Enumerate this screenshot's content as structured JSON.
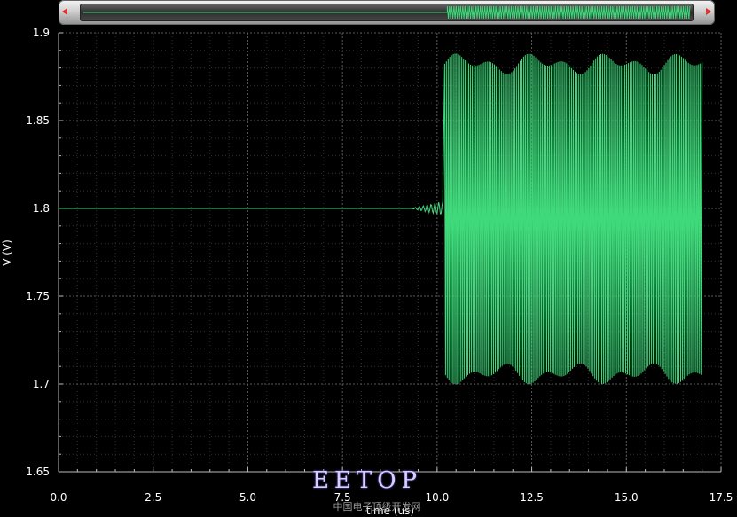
{
  "chart_data": {
    "type": "line",
    "title": "",
    "xlabel": "time (us)",
    "ylabel": "V (V)",
    "xlim": [
      0.0,
      17.5
    ],
    "ylim": [
      1.65,
      1.9
    ],
    "x_ticks": [
      "0.0",
      "2.5",
      "5.0",
      "7.5",
      "10.0",
      "12.5",
      "15.0",
      "17.5"
    ],
    "y_ticks": [
      "1.9",
      "1.85",
      "1.8",
      "1.75",
      "1.7",
      "1.65"
    ],
    "grid": true,
    "background": "#000000",
    "series": [
      {
        "color": "#3fd87a",
        "segments": [
          {
            "x_start": 0.0,
            "x_end": 9.3,
            "kind": "flat",
            "value": 1.8
          },
          {
            "x_start": 9.3,
            "x_end": 10.15,
            "kind": "small-ripple",
            "center": 1.8,
            "amplitude": 0.004
          },
          {
            "x_start": 10.2,
            "x_end": 17.0,
            "kind": "oscillation",
            "max": 1.889,
            "min": 1.699
          }
        ]
      }
    ]
  },
  "scrollbar": {
    "left_arrow_color": "#e03030",
    "right_arrow_color": "#e03030"
  },
  "watermark": {
    "text": "EETOP",
    "subtitle": "中国电子顶级开发网"
  }
}
